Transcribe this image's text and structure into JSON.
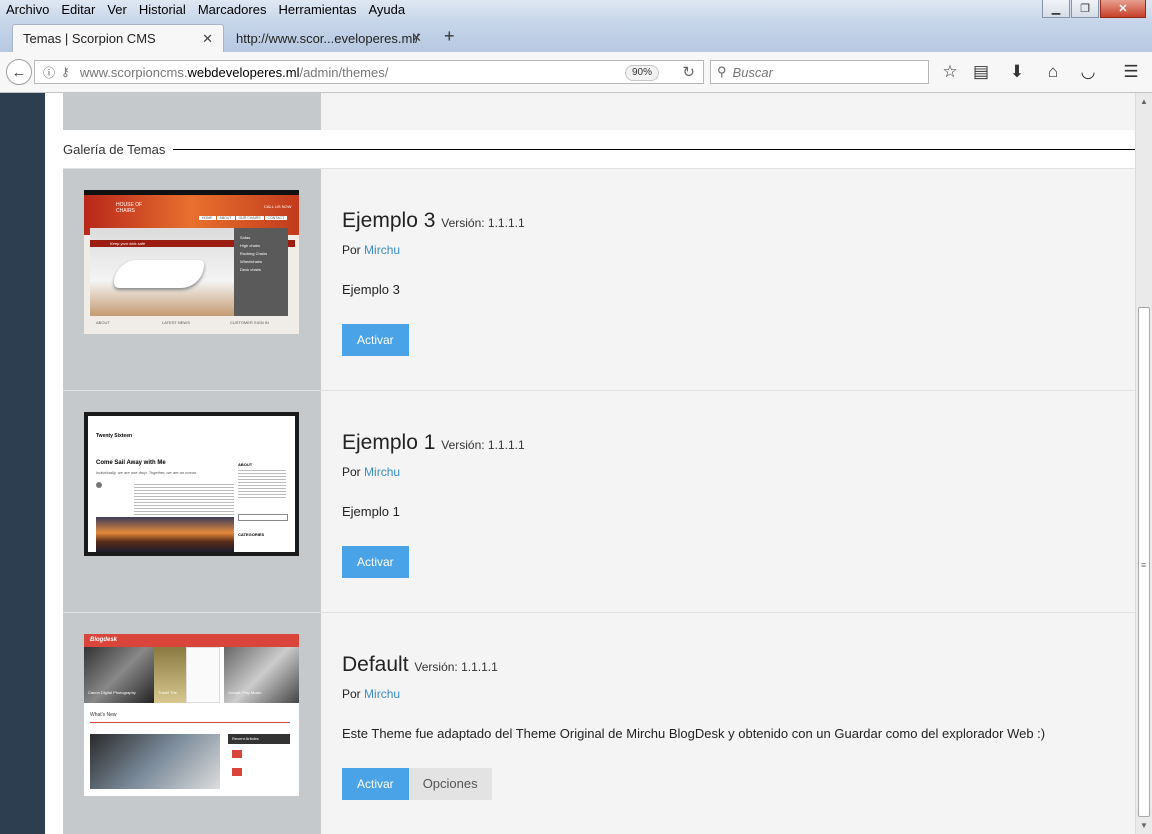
{
  "menubar": {
    "items": [
      "Archivo",
      "Editar",
      "Ver",
      "Historial",
      "Marcadores",
      "Herramientas",
      "Ayuda"
    ]
  },
  "tabs": [
    {
      "title": "Temas | Scorpion CMS",
      "active": true
    },
    {
      "title": "http://www.scor...eveloperes.ml/",
      "active": false
    }
  ],
  "navbar": {
    "url_prefix": "www.scorpioncms.",
    "url_domain": "webdeveloperes.ml",
    "url_path": "/admin/themes/",
    "zoom": "90%",
    "search_placeholder": "Buscar"
  },
  "gallery": {
    "title": "Galería de Temas"
  },
  "themes": [
    {
      "name": "Ejemplo 3",
      "version_label": "Versión: 1.1.1.1",
      "by_label": "Por",
      "author": "Mirchu",
      "description": "Ejemplo 3",
      "activate_label": "Activar",
      "thumb": {
        "brand": "HOUSE OF CHAIRS",
        "phone": "CALL US NOW",
        "nav": [
          "HOME",
          "ABOUT",
          "OUR CHAIRS",
          "CONTACT"
        ],
        "menu": [
          "Sofas",
          "High chairs",
          "Rocking Chairs",
          "Wheelchairs",
          "Deck chairs"
        ],
        "footer": [
          "ABOUT",
          "LATEST NEWS",
          "CUSTOMER SIGN IN"
        ],
        "tagline": "Keep your kids safe"
      }
    },
    {
      "name": "Ejemplo 1",
      "version_label": "Versión: 1.1.1.1",
      "by_label": "Por",
      "author": "Mirchu",
      "description": "Ejemplo 1",
      "activate_label": "Activar",
      "thumb": {
        "site": "Twenty Sixteen",
        "post_title": "Come Sail Away with Me",
        "subtitle": "Individually, we are one drop. Together, we are an ocean.",
        "widgets": [
          "ABOUT",
          "CATEGORIES"
        ]
      }
    },
    {
      "name": "Default",
      "version_label": "Versión: 1.1.1.1",
      "by_label": "Por",
      "author": "Mirchu",
      "description": "Este Theme fue adaptado del Theme Original de Mirchu BlogDesk y obtenido con un Guardar como del explorador Web :)",
      "activate_label": "Activar",
      "options_label": "Opciones",
      "thumb": {
        "brand": "Blogdesk",
        "captions": [
          "Canon Digital Photography",
          "Travel The",
          "Google Play Music"
        ],
        "section": "What's New",
        "sidebar": "Recent Articles"
      }
    }
  ],
  "colors": {
    "sidebar": "#2c3e50",
    "accent": "#4aa3e6",
    "link": "#3b8ec8",
    "thumb_bg": "#c6c9cc"
  }
}
